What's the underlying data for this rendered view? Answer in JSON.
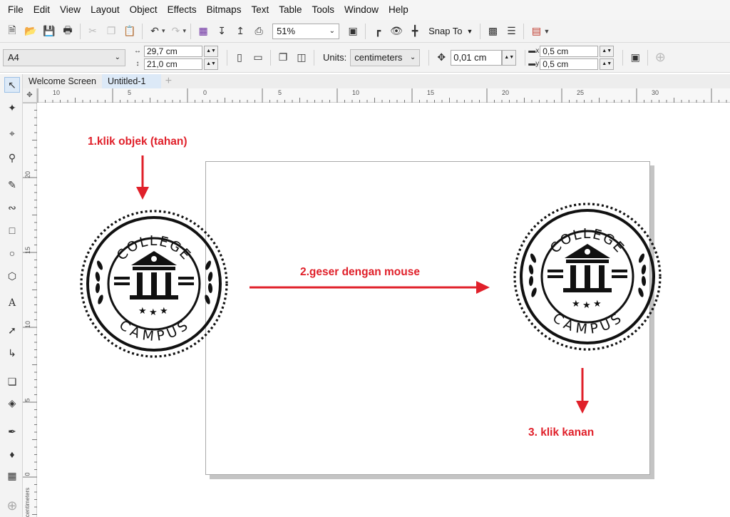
{
  "menu": [
    "File",
    "Edit",
    "View",
    "Layout",
    "Object",
    "Effects",
    "Bitmaps",
    "Text",
    "Table",
    "Tools",
    "Window",
    "Help"
  ],
  "toolbar": {
    "zoom": "51%",
    "snap_label": "Snap To"
  },
  "property_bar": {
    "page_preset": "A4",
    "width": "29,7 cm",
    "height": "21,0 cm",
    "units_label": "Units:",
    "units_value": "centimeters",
    "nudge": "0,01 cm",
    "dup_x": "0,5 cm",
    "dup_y": "0,5 cm"
  },
  "tabs": [
    "Welcome Screen",
    "Untitled-1"
  ],
  "ruler": {
    "top": [
      "10",
      "5",
      "0",
      "5",
      "10",
      "15",
      "20",
      "25",
      "30"
    ],
    "left": [
      "20",
      "15",
      "10",
      "5",
      "0"
    ],
    "unit_label": "centimeters"
  },
  "annotations": {
    "step1": "1.klik objek (tahan)",
    "step2": "2.geser dengan mouse",
    "step3": "3. klik kanan"
  },
  "logo": {
    "top_text": "COLLEGE",
    "bottom_text": "CAMPUS"
  },
  "colors": {
    "annotation": "#e0202a",
    "active_tab": "#dce9f7",
    "logo": "#111111"
  }
}
